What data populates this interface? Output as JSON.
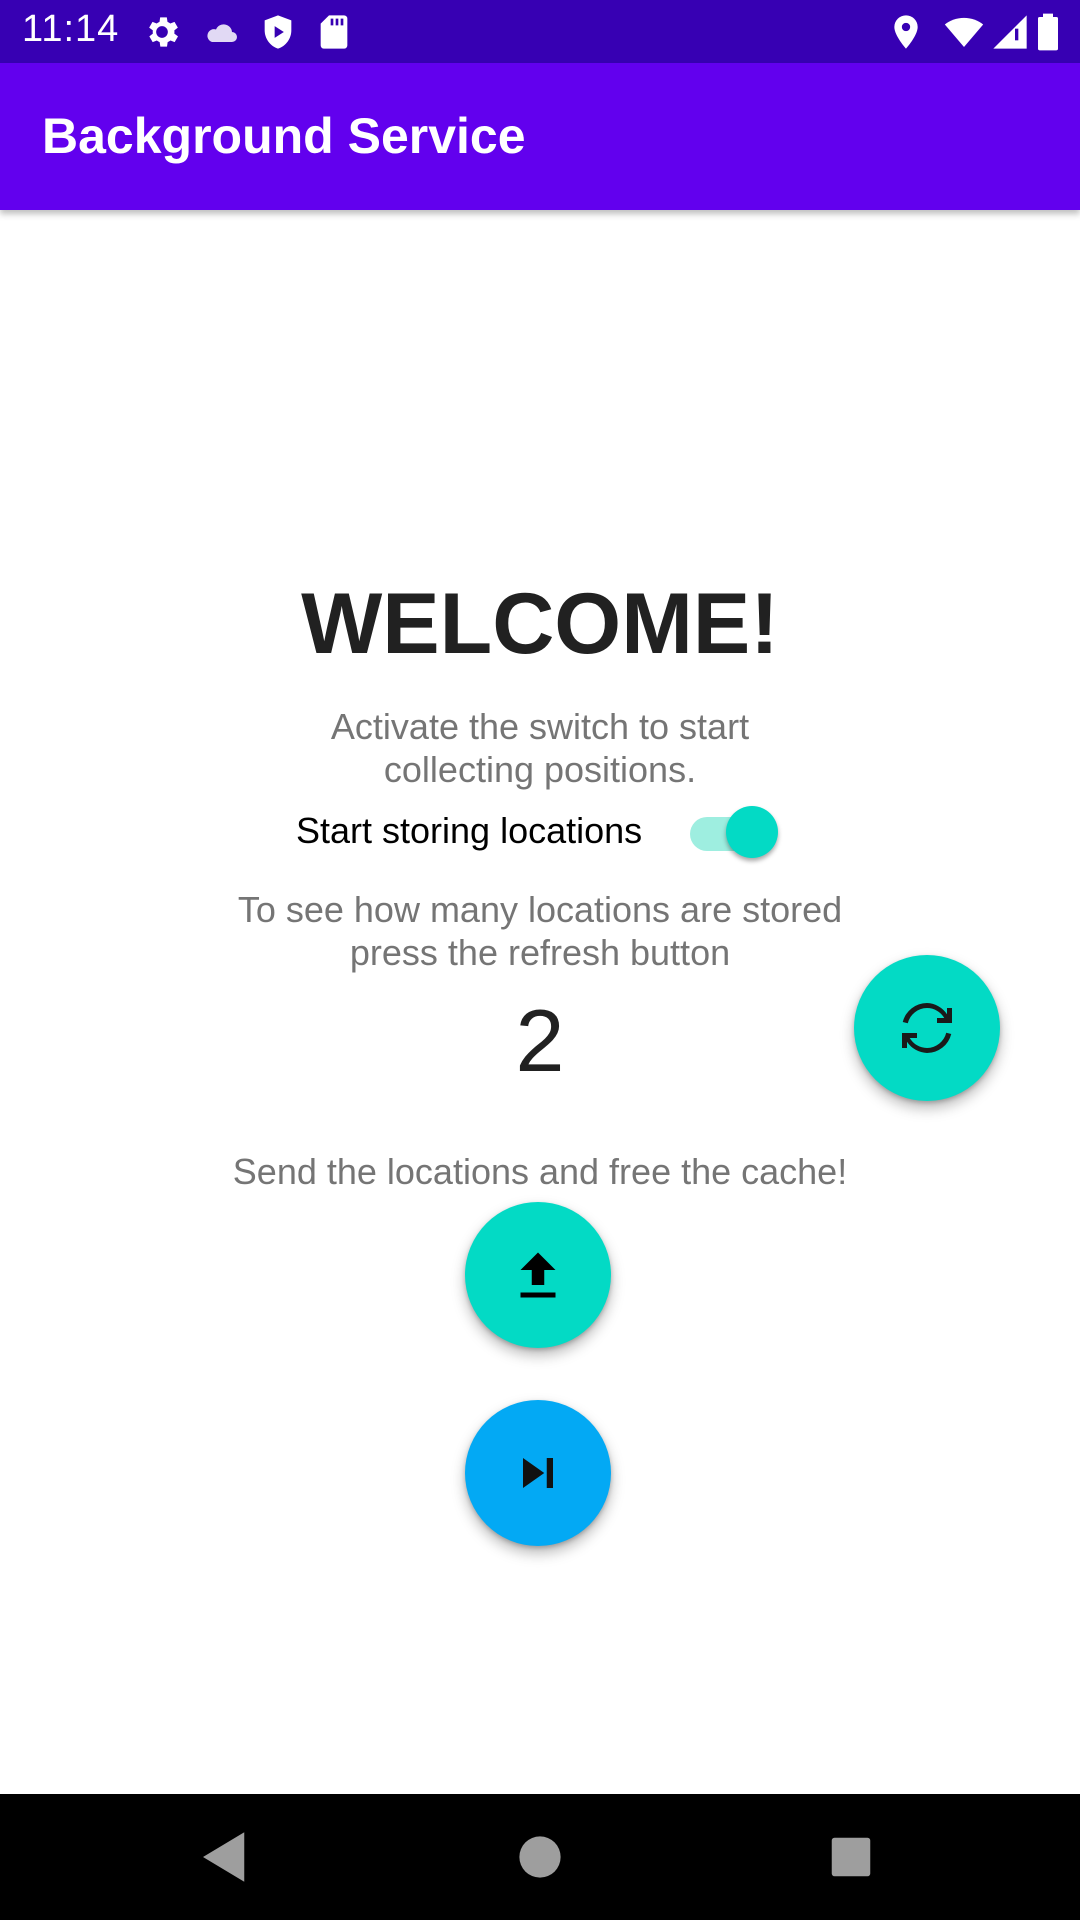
{
  "status_bar": {
    "time": "11:14",
    "left_icons": [
      "gear-icon",
      "cloud-icon",
      "shield-play-icon",
      "sd-card-icon"
    ],
    "right_icons": [
      "location-pin-icon",
      "wifi-icon",
      "signal-icon",
      "battery-icon"
    ]
  },
  "app_bar": {
    "title": "Background Service",
    "color": "#6200ee"
  },
  "main": {
    "heading": "WELCOME!",
    "switch_hint_line1": "Activate the switch to start",
    "switch_hint_line2": "collecting positions.",
    "switch_label": "Start storing locations",
    "switch_on": true,
    "refresh_hint_line1": "To see how many locations are stored",
    "refresh_hint_line2": "press the refresh button",
    "stored_count": "2",
    "send_hint": "Send the locations and free the cache!"
  },
  "buttons": {
    "refresh": {
      "icon": "refresh-icon",
      "color": "#03dac5"
    },
    "upload": {
      "icon": "upload-icon",
      "color": "#03dac5"
    },
    "skip": {
      "icon": "skip-next-icon",
      "color": "#03a9f4"
    }
  },
  "nav_bar": {
    "buttons": [
      "back-icon",
      "home-icon",
      "recents-icon"
    ]
  }
}
